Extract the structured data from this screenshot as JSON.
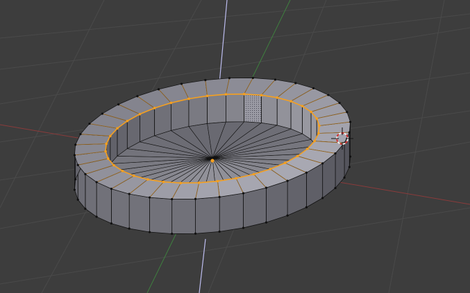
{
  "viewport": {
    "background": "#3d3d3d",
    "grid_color": "#4a4a4a",
    "x_axis_color": "#8a3b3b",
    "y_axis_color": "#3f7f3f",
    "z_axis_color": "#bdbdf0"
  },
  "mesh": {
    "segments": 36,
    "selected_color": "#f5a020",
    "wire_color": "#111111",
    "vertex_color": "#111111",
    "wall_face_color": "#5e5e66",
    "top_face_color": "#a8a8b4",
    "floor_color": "#85858f",
    "inner_wall_color": "#8d8d96",
    "selected_face": "dotted-face"
  },
  "cursor_3d": {
    "icon": "3d-cursor-icon",
    "ring_colors": [
      "#d23030",
      "#f0f0f0"
    ]
  }
}
